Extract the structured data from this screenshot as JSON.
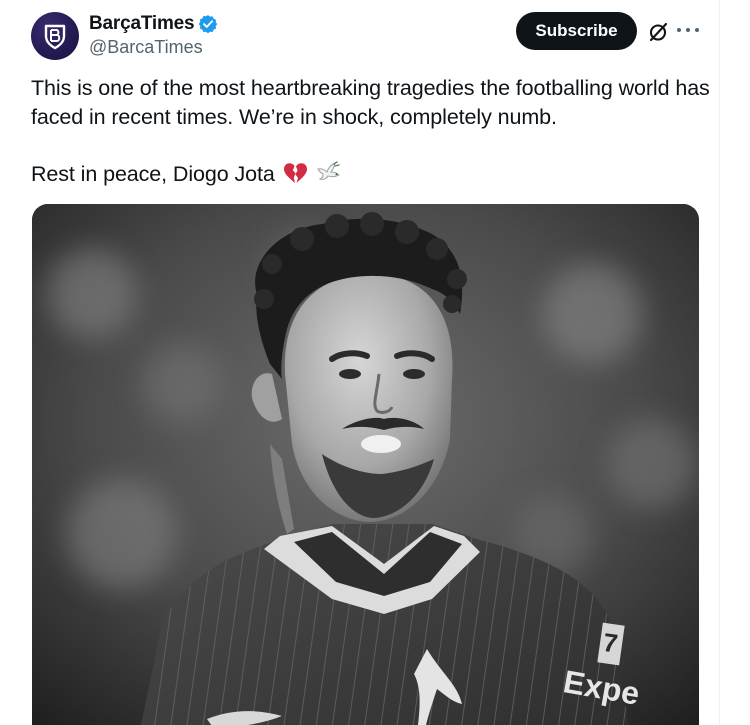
{
  "author": {
    "display_name": "BarçaTimes",
    "handle": "@BarcaTimes",
    "verified": true,
    "avatar_icon": "barcatimes-crest-icon",
    "avatar_color": "#241a52"
  },
  "actions": {
    "subscribe_label": "Subscribe",
    "subscribe_color": "#0f1419",
    "grok_icon": "grok-icon",
    "more_icon": "more-icon"
  },
  "tweet": {
    "paragraph_1": "This is one of the most heartbreaking tragedies the footballing world has faced in recent times. We’re in shock, completely numb.",
    "paragraph_2": "Rest in peace, Diogo Jota",
    "emojis": [
      "broken-heart-icon",
      "dove-icon"
    ]
  },
  "media": {
    "image_icon": "player-photo",
    "shirt_sponsor_text": "Expe",
    "shirt_number_text": "7"
  },
  "colors": {
    "text_primary": "#0f1419",
    "text_secondary": "#536471",
    "verified_blue": "#1d9bf0",
    "broken_heart_red": "#d32b44"
  }
}
